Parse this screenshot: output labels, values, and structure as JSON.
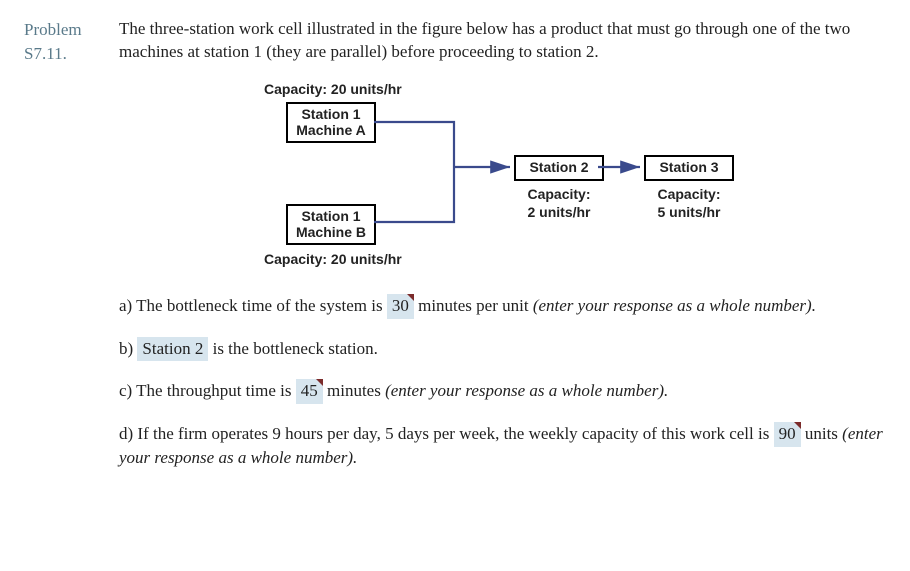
{
  "problem_label_line1": "Problem",
  "problem_label_line2": "S7.11.",
  "problem_text": "The three-station work cell illustrated in the figure below has a product that must go through one of the two machines at station 1 (they are parallel) before proceeding to station 2.",
  "diagram": {
    "capacity_top": "Capacity: 20 units/hr",
    "machine_a_line1": "Station 1",
    "machine_a_line2": "Machine A",
    "machine_b_line1": "Station 1",
    "machine_b_line2": "Machine B",
    "capacity_bot": "Capacity: 20 units/hr",
    "station2_label": "Station 2",
    "station2_cap_line1": "Capacity:",
    "station2_cap_line2": "2 units/hr",
    "station3_label": "Station 3",
    "station3_cap_line1": "Capacity:",
    "station3_cap_line2": "5 units/hr"
  },
  "q_a_pre": "a) The bottleneck time of the system is ",
  "q_a_ans": "30",
  "q_a_post": " minutes per unit ",
  "q_a_hint": "(enter your response as a whole number).",
  "q_b_pre": "b) ",
  "q_b_ans": "Station 2",
  "q_b_post": " is the bottleneck station.",
  "q_c_pre": "c) The throughput time is ",
  "q_c_ans": "45",
  "q_c_post": " minutes ",
  "q_c_hint": "(enter your response as a whole number).",
  "q_d_pre": "d) If the firm operates 9 hours per day, 5 days per week, the weekly capacity of this work cell is ",
  "q_d_ans": "90",
  "q_d_post": " units ",
  "q_d_hint": "(enter your response as a whole number)."
}
